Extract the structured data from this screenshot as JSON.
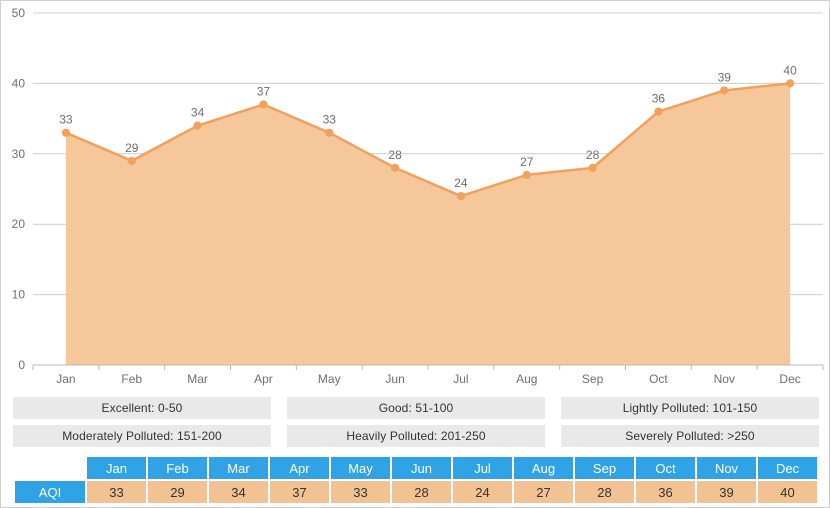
{
  "chart_data": {
    "type": "area",
    "title": "",
    "xlabel": "",
    "ylabel": "",
    "categories": [
      "Jan",
      "Feb",
      "Mar",
      "Apr",
      "May",
      "Jun",
      "Jul",
      "Aug",
      "Sep",
      "Oct",
      "Nov",
      "Dec"
    ],
    "series": [
      {
        "name": "AQI",
        "values": [
          33,
          29,
          34,
          37,
          33,
          28,
          24,
          27,
          28,
          36,
          39,
          40
        ]
      }
    ],
    "values": [
      33,
      29,
      34,
      37,
      33,
      28,
      24,
      27,
      28,
      36,
      39,
      40
    ],
    "ylim": [
      0,
      50
    ],
    "yticks": [
      0,
      10,
      20,
      30,
      40,
      50
    ],
    "ytick_labels": [
      "0",
      "10",
      "20",
      "30",
      "40",
      "50"
    ],
    "xtick_labels": [
      "Jan",
      "Feb",
      "Mar",
      "Apr",
      "May",
      "Jun",
      "Jul",
      "Aug",
      "Sep",
      "Oct",
      "Nov",
      "Dec"
    ],
    "grid": true,
    "legend_position": "below-chart",
    "colors": {
      "line": "#f2a05a",
      "area": "#f5c79b",
      "point": "#f2a05a",
      "grid": "#cccccc",
      "axis": "#b8b8b8",
      "tick_text": "#6e7079",
      "data_label": "#6e7079"
    },
    "data_labels": [
      "33",
      "29",
      "34",
      "37",
      "33",
      "28",
      "24",
      "27",
      "28",
      "36",
      "39",
      "40"
    ]
  },
  "legend": {
    "items": [
      {
        "label": "Excellent: 0-50"
      },
      {
        "label": "Good: 51-100"
      },
      {
        "label": "Lightly Polluted: 101-150"
      },
      {
        "label": "Moderately Polluted: 151-200"
      },
      {
        "label": "Heavily Polluted: 201-250"
      },
      {
        "label": "Severely Polluted: >250"
      }
    ]
  },
  "table": {
    "row_label": "AQI",
    "columns": [
      "Jan",
      "Feb",
      "Mar",
      "Apr",
      "May",
      "Jun",
      "Jul",
      "Aug",
      "Sep",
      "Oct",
      "Nov",
      "Dec"
    ],
    "values": [
      "33",
      "29",
      "34",
      "37",
      "33",
      "28",
      "24",
      "27",
      "28",
      "36",
      "39",
      "40"
    ],
    "header_color": "#2fa3e6",
    "cell_color": "#f2c293"
  }
}
